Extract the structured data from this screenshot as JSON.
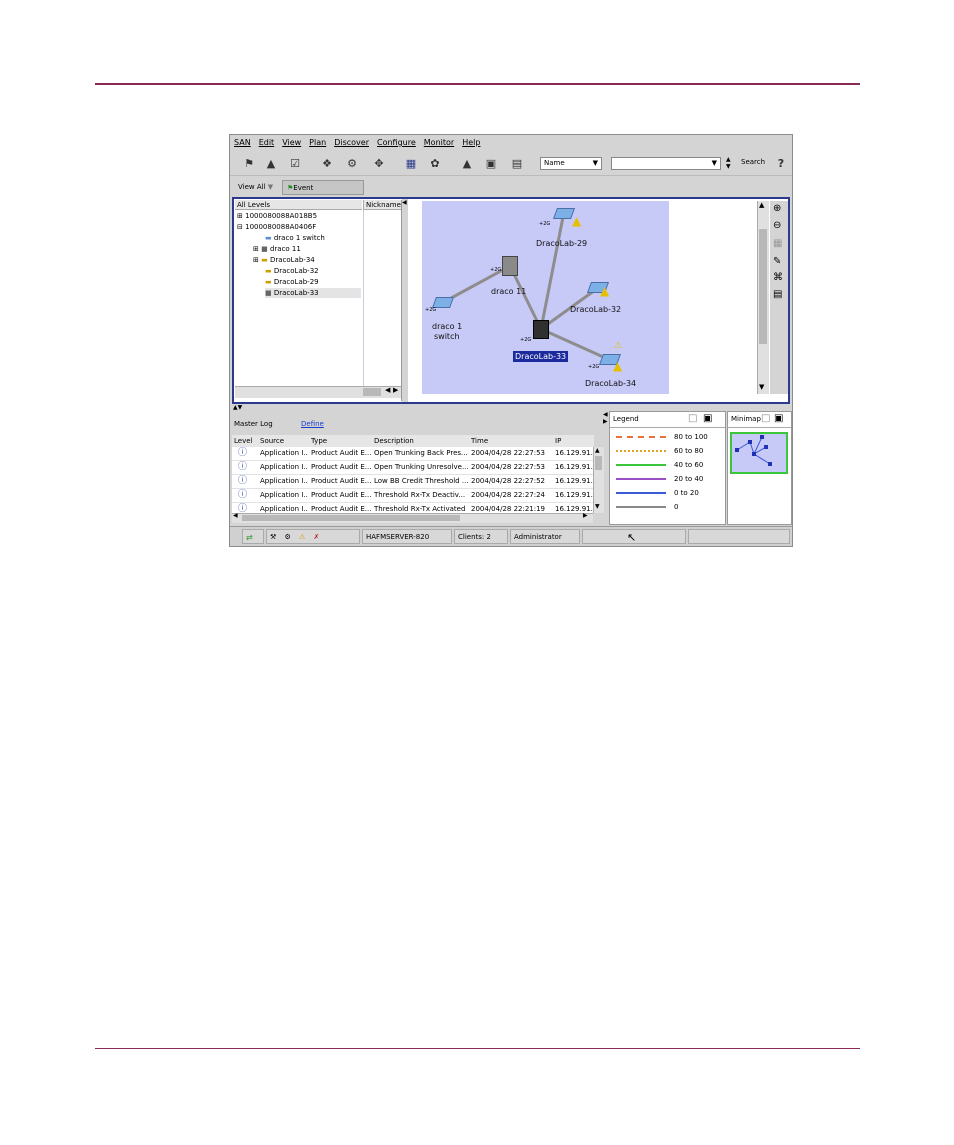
{
  "menu": [
    "SAN",
    "Edit",
    "View",
    "Plan",
    "Discover",
    "Configure",
    "Monitor",
    "Help"
  ],
  "toolbar": {
    "find_by": "Name",
    "search_label": "Search",
    "help_icon": "?"
  },
  "tabs": {
    "view": "View All",
    "event": "Event Management"
  },
  "tree": {
    "col_levels": "All Levels",
    "col_nickname": "Nickname",
    "items": [
      "1000080088A018B5",
      "1000080088A0406F",
      "draco 1 switch",
      "draco 11",
      "DracoLab-34",
      "DracoLab-32",
      "DracoLab-29",
      "DracoLab-33"
    ]
  },
  "map": {
    "nodes": {
      "dracolab29": "DracoLab-29",
      "draco11": "draco 11",
      "dracolab32": "DracoLab-32",
      "draco1_line1": "draco 1",
      "draco1_line2": "switch",
      "dracolab33": "DracoLab-33",
      "dracolab34": "DracoLab-34"
    },
    "port_label": "+2G"
  },
  "log": {
    "title": "Master Log",
    "define": "Define",
    "columns": [
      "Level",
      "Source",
      "Type",
      "Description",
      "Time",
      "IP"
    ],
    "rows": [
      {
        "source": "Application I...",
        "type": "Product Audit E...",
        "desc": "Open Trunking Back Pres...",
        "time": "2004/04/28 22:27:53",
        "ip": "16.129.91..."
      },
      {
        "source": "Application I...",
        "type": "Product Audit E...",
        "desc": "Open Trunking Unresolve...",
        "time": "2004/04/28 22:27:53",
        "ip": "16.129.91..."
      },
      {
        "source": "Application I...",
        "type": "Product Audit E...",
        "desc": "Low BB Credit Threshold ...",
        "time": "2004/04/28 22:27:52",
        "ip": "16.129.91..."
      },
      {
        "source": "Application I...",
        "type": "Product Audit E...",
        "desc": "Threshold Rx-Tx Deactiv...",
        "time": "2004/04/28 22:27:24",
        "ip": "16.129.91..."
      },
      {
        "source": "Application I...",
        "type": "Product Audit E...",
        "desc": "Threshold Rx-Tx Activated",
        "time": "2004/04/28 22:21:19",
        "ip": "16.129.91..."
      }
    ]
  },
  "legend": {
    "title": "Legend",
    "items": [
      {
        "label": "80 to 100",
        "color": "#e8703a"
      },
      {
        "label": "60 to 80",
        "color": "#e0a020"
      },
      {
        "label": "40 to 60",
        "color": "#3cc63c"
      },
      {
        "label": "20 to 40",
        "color": "#9b4fc4"
      },
      {
        "label": "0 to 20",
        "color": "#3a5ad8"
      },
      {
        "label": "0",
        "color": "#888888"
      }
    ]
  },
  "minimap": {
    "title": "Minimap"
  },
  "status": {
    "server": "HAFMSERVER-820",
    "clients": "Clients: 2",
    "user": "Administrator"
  }
}
